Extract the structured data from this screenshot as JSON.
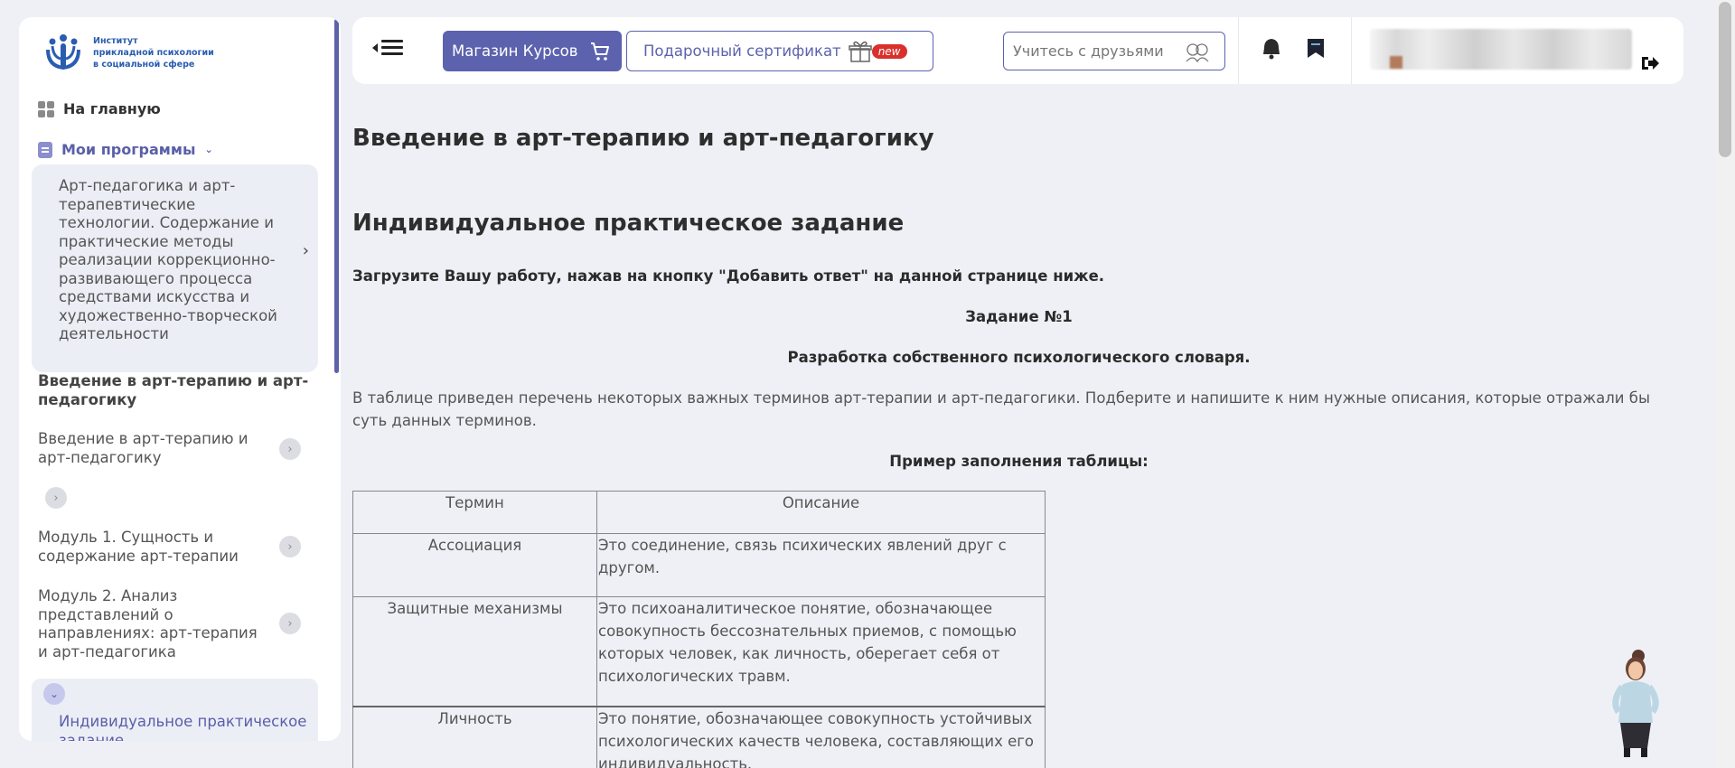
{
  "colors": {
    "accent": "#5c62ad",
    "badge": "#d9302c",
    "background": "#eef0f6"
  },
  "sidebar": {
    "logo": {
      "line1": "Институт",
      "line2": "прикладной психологии",
      "line3": "в социальной сфере"
    },
    "home": "На главную",
    "my_programs": "Мои программы",
    "program": "Арт-педагогика и арт-терапевтические технологии. Содержание и практические методы реализации коррекционно-развивающего процесса средствами искусства и художественно-творческой деятельности",
    "section_title": "Введение в арт-терапию и арт-педагогику",
    "items": [
      {
        "label": "Введение в арт-терапию и арт-педагогику"
      },
      {
        "label": "Модуль 1. Сущность и содержание арт-терапии"
      },
      {
        "label": "Модуль 2. Анализ представлений о направлениях: арт-терапия и арт-педагогика"
      }
    ],
    "active_item": "Индивидуальное практическое задание"
  },
  "topbar": {
    "shop_label": "Магазин Курсов",
    "gift_label": "Подарочный сертификат",
    "new_badge": "new",
    "search_placeholder": "Учитесь с друзьями"
  },
  "content": {
    "title": "Введение в арт-терапию и арт-педагогику",
    "subtitle": "Индивидуальное практическое задание",
    "instruction": "Загрузите Вашу работу, нажав на кнопку \"Добавить ответ\" на данной странице ниже.",
    "task_number": "Задание №1",
    "task_title": "Разработка собственного психологического словаря.",
    "description": "В таблице приведен перечень некоторых важных терминов арт-терапии и арт-педагогики. Подберите и напишите к ним нужные описания, которые отражали бы суть данных терминов.",
    "example_title": "Пример заполнения таблицы:",
    "table": {
      "headers": [
        "Термин",
        "Описание"
      ],
      "rows": [
        {
          "term": "Ассоциация",
          "desc": "Это соединение, связь психических явлений друг с другом."
        },
        {
          "term": "Защитные механизмы",
          "desc": "Это психоаналитическое понятие, обозначающее совокупность бессознательных приемов, с помощью которых человек, как личность, оберегает себя от психологических травм."
        },
        {
          "term": "Личность",
          "desc": "Это понятие, обозначающее совокупность устойчивых психологических качеств человека, составляющих его индивидуальность."
        }
      ]
    }
  }
}
